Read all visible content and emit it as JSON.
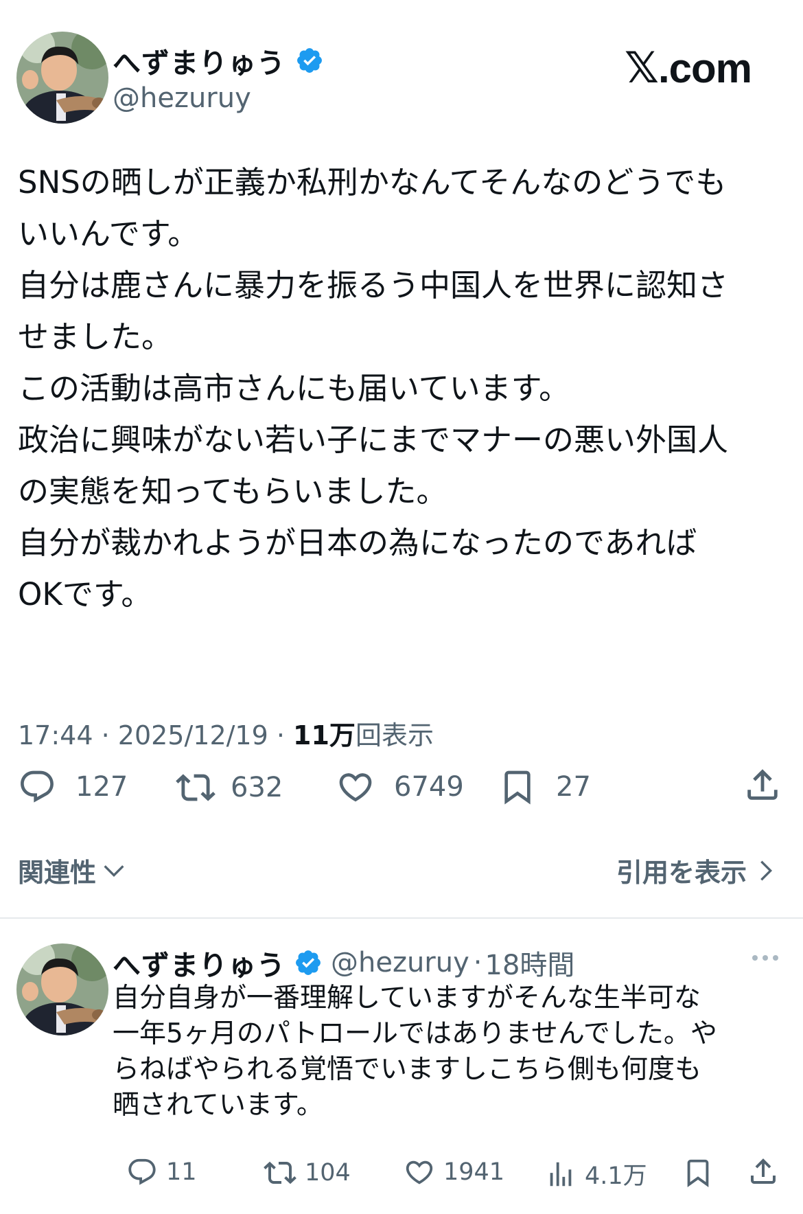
{
  "brand": {
    "x_glyph": "𝕏",
    "domain": ".com"
  },
  "post": {
    "author_name": "へずまりゅう",
    "handle": "@hezuruy",
    "body_lines": [
      "SNSの晒しが正義か私刑かなんてそんなのどうでも",
      "いいんです。",
      "自分は鹿さんに暴力を振るう中国人を世界に認知さ",
      "せました。",
      "この活動は高市さんにも届いています。",
      "政治に興味がない若い子にまでマナーの悪い外国人",
      "の実態を知ってもらいました。",
      "自分が裁かれようが日本の為になったのであれば",
      "OKです。"
    ],
    "time": "17:44",
    "sep": " · ",
    "date": "2025/12/19",
    "views_count": "11万",
    "views_label": "回表示",
    "replies": "127",
    "reposts": "632",
    "likes": "6749",
    "bookmarks": "27",
    "related_label": "関連性",
    "quotes_label": "引用を表示"
  },
  "reply": {
    "author_name": "へずまりゅう",
    "handle": "@hezuruy",
    "sep": "·",
    "time_ago": "18時間",
    "body_lines": [
      "自分自身が一番理解していますがそんな生半可な",
      "一年5ヶ月のパトロールではありませんでした。や",
      "らねばやられる覚悟でいますしこちら側も何度も",
      "晒されています。"
    ],
    "replies": "11",
    "reposts": "104",
    "likes": "1941",
    "views": "4.1万"
  },
  "colors": {
    "text": "#0f1419",
    "muted": "#536471",
    "verified": "#1d9bf0",
    "divider": "#e6e9ec"
  },
  "icons": [
    "verified-badge-icon",
    "reply-icon",
    "repost-icon",
    "like-icon",
    "bookmark-icon",
    "share-icon",
    "views-icon",
    "chevron-down-icon",
    "chevron-right-icon",
    "more-icon"
  ]
}
